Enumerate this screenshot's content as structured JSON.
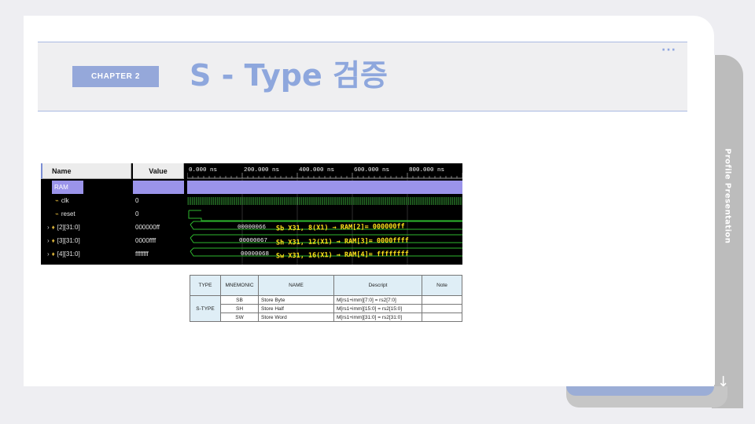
{
  "side_tab": {
    "label": "Profile Presentation",
    "arrow": "↓"
  },
  "header": {
    "chapter": "CHAPTER 2",
    "title": "S - Type 검증",
    "dots": "···"
  },
  "waveform": {
    "name_header": "Name",
    "value_header": "Value",
    "signals": [
      {
        "name": "RAM",
        "value": "",
        "icon": ""
      },
      {
        "name": "clk",
        "value": "0",
        "icon": "signal-icon"
      },
      {
        "name": "reset",
        "value": "0",
        "icon": "signal-icon"
      },
      {
        "name": "[2][31:0]",
        "value": "000000ff",
        "icon": "bus-icon"
      },
      {
        "name": "[3][31:0]",
        "value": "0000ffff",
        "icon": "bus-icon"
      },
      {
        "name": "[4][31:0]",
        "value": "ffffffff",
        "icon": "bus-icon"
      }
    ],
    "time_ticks": [
      "0.000 ns",
      "200.000 ns",
      "400.000 ns",
      "600.000 ns",
      "800.000 ns"
    ],
    "bus_values": [
      "00000066",
      "00000067",
      "00000068"
    ],
    "annotations": [
      "Sb X31, 8(X1) → RAM[2]= 000000ff",
      "Sh X31, 12(X1) → RAM[3]= 0000ffff",
      "Sw X31, 16(X1) → RAM[4]= ffffffff"
    ],
    "colors": {
      "clk": "#3aa83a",
      "bus": "#2eb82e",
      "ram": "#9b94ea",
      "annotation": "#ffe21a"
    }
  },
  "table": {
    "headers": [
      "TYPE",
      "MNEMONIC",
      "NAME",
      "Descript",
      "Note"
    ],
    "type_label": "S-TYPE",
    "rows": [
      {
        "mnemonic": "SB",
        "name": "Store Byte",
        "descript": "M[rs1+imm][7:0] = rs2[7:0]",
        "note": ""
      },
      {
        "mnemonic": "SH",
        "name": "Store Half",
        "descript": "M[rs1+imm][15:0] = rs2[15:0]",
        "note": ""
      },
      {
        "mnemonic": "SW",
        "name": "Store Word",
        "descript": "M[rs1+imm][31:0] = rs2[31:0]",
        "note": ""
      }
    ]
  }
}
